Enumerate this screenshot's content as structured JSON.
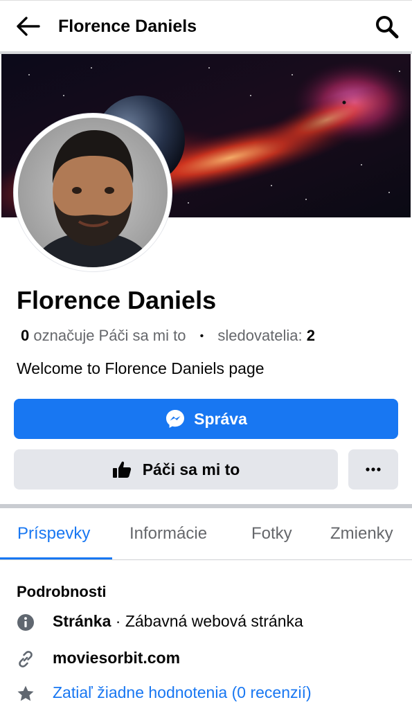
{
  "header": {
    "title": "Florence Daniels"
  },
  "profile": {
    "name": "Florence Daniels",
    "likes_count": "0",
    "likes_label": "označuje Páči sa mi to",
    "followers_label": "sledovatelia:",
    "followers_count": "2",
    "bio": "Welcome to Florence Daniels page"
  },
  "actions": {
    "message_label": "Správa",
    "like_label": "Páči sa mi to",
    "more_label": "•••"
  },
  "tabs": [
    {
      "label": "Príspevky",
      "active": true
    },
    {
      "label": "Informácie",
      "active": false
    },
    {
      "label": "Fotky",
      "active": false
    },
    {
      "label": "Zmienky",
      "active": false
    }
  ],
  "details": {
    "title": "Podrobnosti",
    "page_type_label": "Stránka",
    "page_type_value": "· Zábavná webová stránka",
    "website": "moviesorbit.com",
    "reviews": "Zatiaľ žiadne hodnotenia (0 recenzií)"
  },
  "colors": {
    "accent": "#1877f2",
    "button_gray": "#e4e6eb",
    "secondary_text": "#65676b"
  },
  "icons": [
    "back-arrow-icon",
    "search-icon",
    "messenger-icon",
    "thumbs-up-icon",
    "more-dots-icon",
    "info-icon",
    "link-icon",
    "star-icon"
  ]
}
